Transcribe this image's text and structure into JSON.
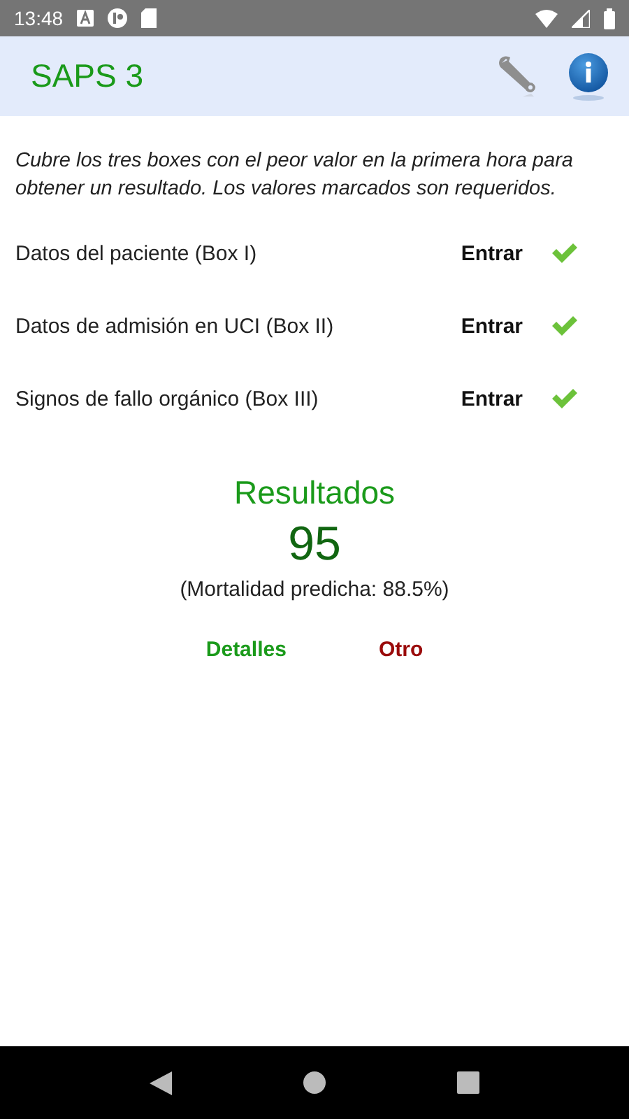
{
  "status_bar": {
    "time": "13:48"
  },
  "app_bar": {
    "title": "SAPS 3"
  },
  "instructions": "Cubre los tres boxes con el peor valor en la primera hora para obtener un resultado. Los valores marcados son requeridos.",
  "boxes": [
    {
      "label": "Datos del paciente (Box I)",
      "action": "Entrar",
      "checked": true
    },
    {
      "label": "Datos de admisión en UCI (Box II)",
      "action": "Entrar",
      "checked": true
    },
    {
      "label": "Signos de fallo orgánico (Box III)",
      "action": "Entrar",
      "checked": true
    }
  ],
  "results": {
    "title": "Resultados",
    "score": "95",
    "mortality": "(Mortalidad predicha: 88.5%)",
    "buttons": [
      {
        "label": "Detalles",
        "kind": "primary"
      },
      {
        "label": "Otro",
        "kind": "secondary"
      }
    ]
  }
}
